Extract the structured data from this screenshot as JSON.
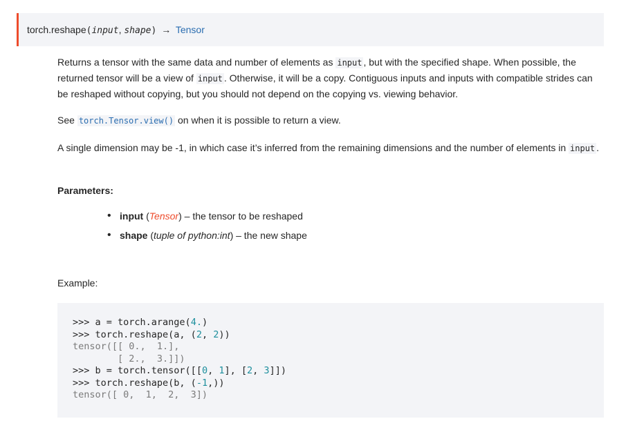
{
  "signature": {
    "name": "torch.reshape",
    "open_paren": "(",
    "param1": "input",
    "comma": ", ",
    "param2": "shape",
    "close_paren": ")",
    "arrow": "→",
    "return_type": "Tensor"
  },
  "description": {
    "p1_a": "Returns a tensor with the same data and number of elements as ",
    "p1_code1": "input",
    "p1_b": ", but with the specified shape. When possible, the returned tensor will be a view of ",
    "p1_code2": "input",
    "p1_c": ". Otherwise, it will be a copy. Contiguous inputs and inputs with compatible strides can be reshaped without copying, but you should not depend on the copying vs. viewing behavior.",
    "p2_a": "See ",
    "p2_link": "torch.Tensor.view()",
    "p2_b": " on when it is possible to return a view.",
    "p3_a": "A single dimension may be -1, in which case it’s inferred from the remaining dimensions and the number of elements in ",
    "p3_code": "input",
    "p3_b": "."
  },
  "parameters": {
    "heading": "Parameters:",
    "items": [
      {
        "name": "input",
        "open": " (",
        "type": "Tensor",
        "close": ")",
        "desc": " – the tensor to be reshaped"
      },
      {
        "name": "shape",
        "open": " (",
        "type": "tuple of python:int",
        "close": ")",
        "desc": " – the new shape"
      }
    ]
  },
  "example": {
    "label": "Example:",
    "code_lines": [
      ">>> a = torch.arange(4.)",
      ">>> torch.reshape(a, (2, 2))",
      "tensor([[ 0.,  1.],",
      "        [ 2.,  3.]])",
      ">>> b = torch.tensor([[0, 1], [2, 3]])",
      ">>> torch.reshape(b, (-1,))",
      "tensor([ 0,  1,  2,  3])"
    ]
  }
}
